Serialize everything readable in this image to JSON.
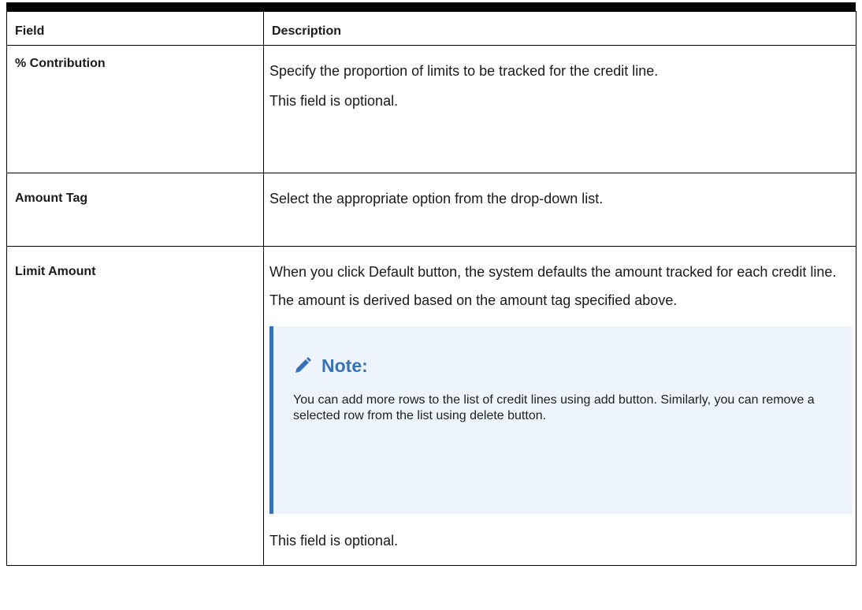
{
  "table": {
    "headers": [
      "Field",
      "Description"
    ],
    "rows": [
      {
        "field": "% Contribution",
        "paragraphs": [
          "Specify the proportion of limits to be tracked for the credit line.",
          "This field is optional."
        ]
      },
      {
        "field": "Amount Tag",
        "paragraphs": [
          "Select the appropriate option from the drop-down list."
        ]
      },
      {
        "field": "Limit Amount",
        "paragraphs": [
          "When you click Default button, the system defaults the amount tracked for each credit line.",
          "The amount is derived based on the amount tag specified above."
        ],
        "note": {
          "title": "Note:",
          "icon": "pencil-icon",
          "body": "You can add more rows to the list of credit lines using add button. Similarly, you can remove a selected row from the list using delete button."
        },
        "trailing": "This field is optional."
      }
    ]
  },
  "colors": {
    "note_accent": "#3872b6",
    "note_background": "#eef4fb"
  }
}
